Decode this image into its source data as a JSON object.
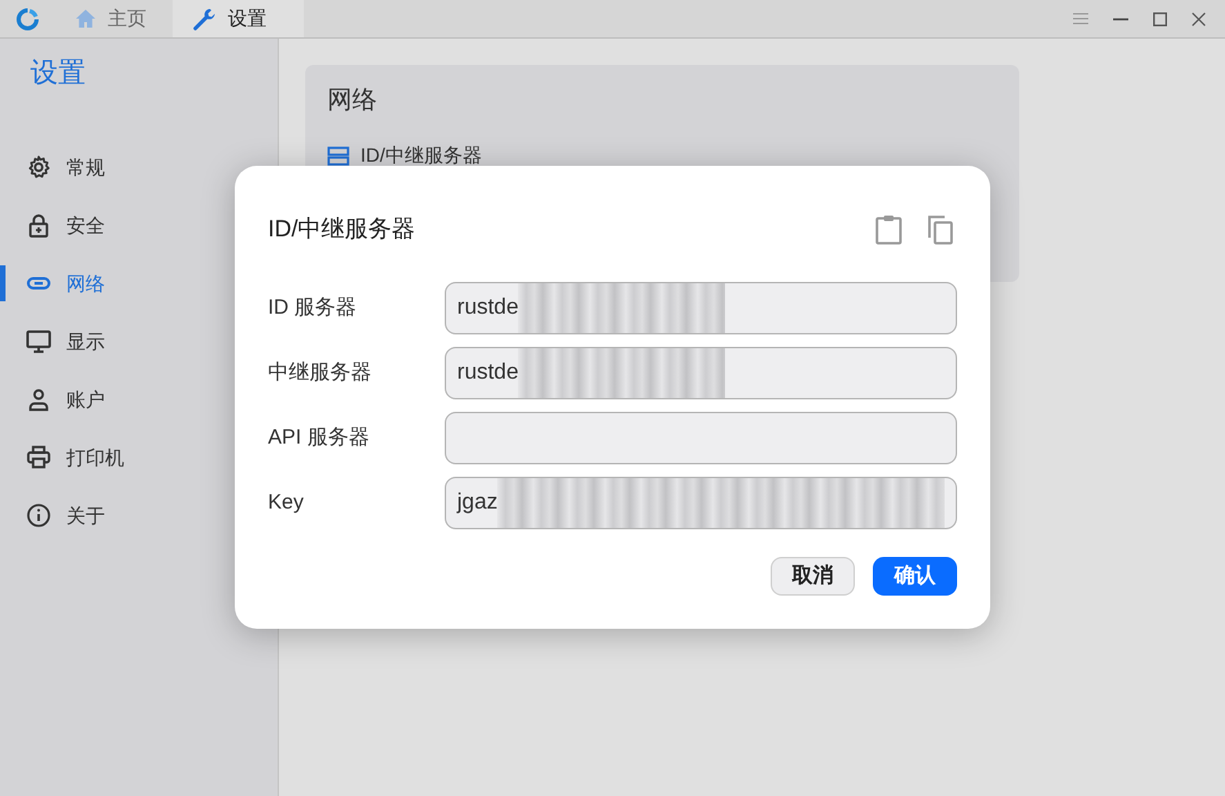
{
  "window": {
    "tabs": [
      {
        "label": "主页",
        "kind": "home",
        "selected": false
      },
      {
        "label": "设置",
        "kind": "settings",
        "selected": true
      }
    ]
  },
  "sidebar": {
    "title": "设置",
    "items": [
      {
        "label": "常规",
        "kind": "gear",
        "selected": false
      },
      {
        "label": "安全",
        "kind": "lock",
        "selected": false
      },
      {
        "label": "网络",
        "kind": "link",
        "selected": true
      },
      {
        "label": "显示",
        "kind": "monitor",
        "selected": false
      },
      {
        "label": "账户",
        "kind": "person",
        "selected": false
      },
      {
        "label": "打印机",
        "kind": "printer",
        "selected": false
      },
      {
        "label": "关于",
        "kind": "info",
        "selected": false
      }
    ]
  },
  "network_card": {
    "title": "网络",
    "item": "ID/中继服务器"
  },
  "dialog": {
    "title": "ID/中继服务器",
    "fields": [
      {
        "label": "ID 服务器",
        "value": "rustde",
        "redacted": true
      },
      {
        "label": "中继服务器",
        "value": "rustde",
        "redacted": true
      },
      {
        "label": "API 服务器",
        "redacted": false
      },
      {
        "label": "Key",
        "value": "jgaz",
        "redacted": true
      }
    ],
    "buttons": [
      {
        "label": "取消",
        "kind": "secondary"
      },
      {
        "label": "确认",
        "kind": "primary"
      }
    ]
  }
}
